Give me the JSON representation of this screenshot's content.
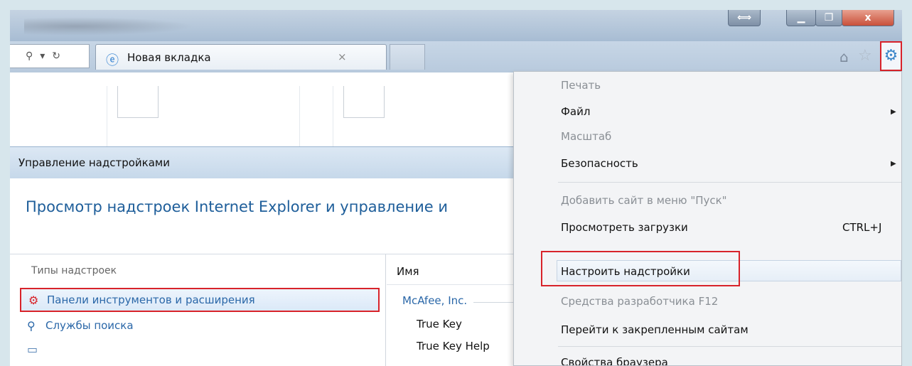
{
  "titlebar": {
    "restore_icon": "arrows-icon",
    "min_icon": "minimize-icon",
    "max_icon": "maximize-icon",
    "close_label": "x"
  },
  "nav": {
    "search_glyph": "⚲",
    "dropdown_glyph": "▾",
    "refresh_glyph": "↻",
    "tab_label": "Новая вкладка",
    "tab_close": "×"
  },
  "dialog": {
    "title": "Управление надстройками",
    "heading": "Просмотр надстроек Internet Explorer и управление и",
    "types_label": "Типы надстроек",
    "types": [
      {
        "label": "Панели инструментов и расширения"
      },
      {
        "label": "Службы поиска"
      },
      {
        "label": ""
      }
    ],
    "column_name": "Имя",
    "publisher": "McAfee, Inc.",
    "items": [
      "True Key",
      "True Key Help"
    ]
  },
  "menu": {
    "items": [
      {
        "label": "Печать",
        "disabled": true
      },
      {
        "label": "Файл",
        "submenu": true
      },
      {
        "label": "Масштаб",
        "disabled": true
      },
      {
        "label": "Безопасность",
        "submenu": true
      },
      {
        "label": "Добавить сайт в меню \"Пуск\"",
        "disabled": true
      },
      {
        "label": "Просмотреть загрузки",
        "shortcut": "CTRL+J"
      },
      {
        "label": "Настроить надстройки",
        "highlighted": true
      },
      {
        "label": "Средства разработчика F12",
        "disabled": true
      },
      {
        "label": "Перейти к закрепленным сайтам"
      },
      {
        "label": "Свойства браузера"
      }
    ]
  },
  "colors": {
    "highlight_border": "#d8232a",
    "link_blue": "#2a67a8",
    "heading_blue": "#1e5e9a"
  }
}
